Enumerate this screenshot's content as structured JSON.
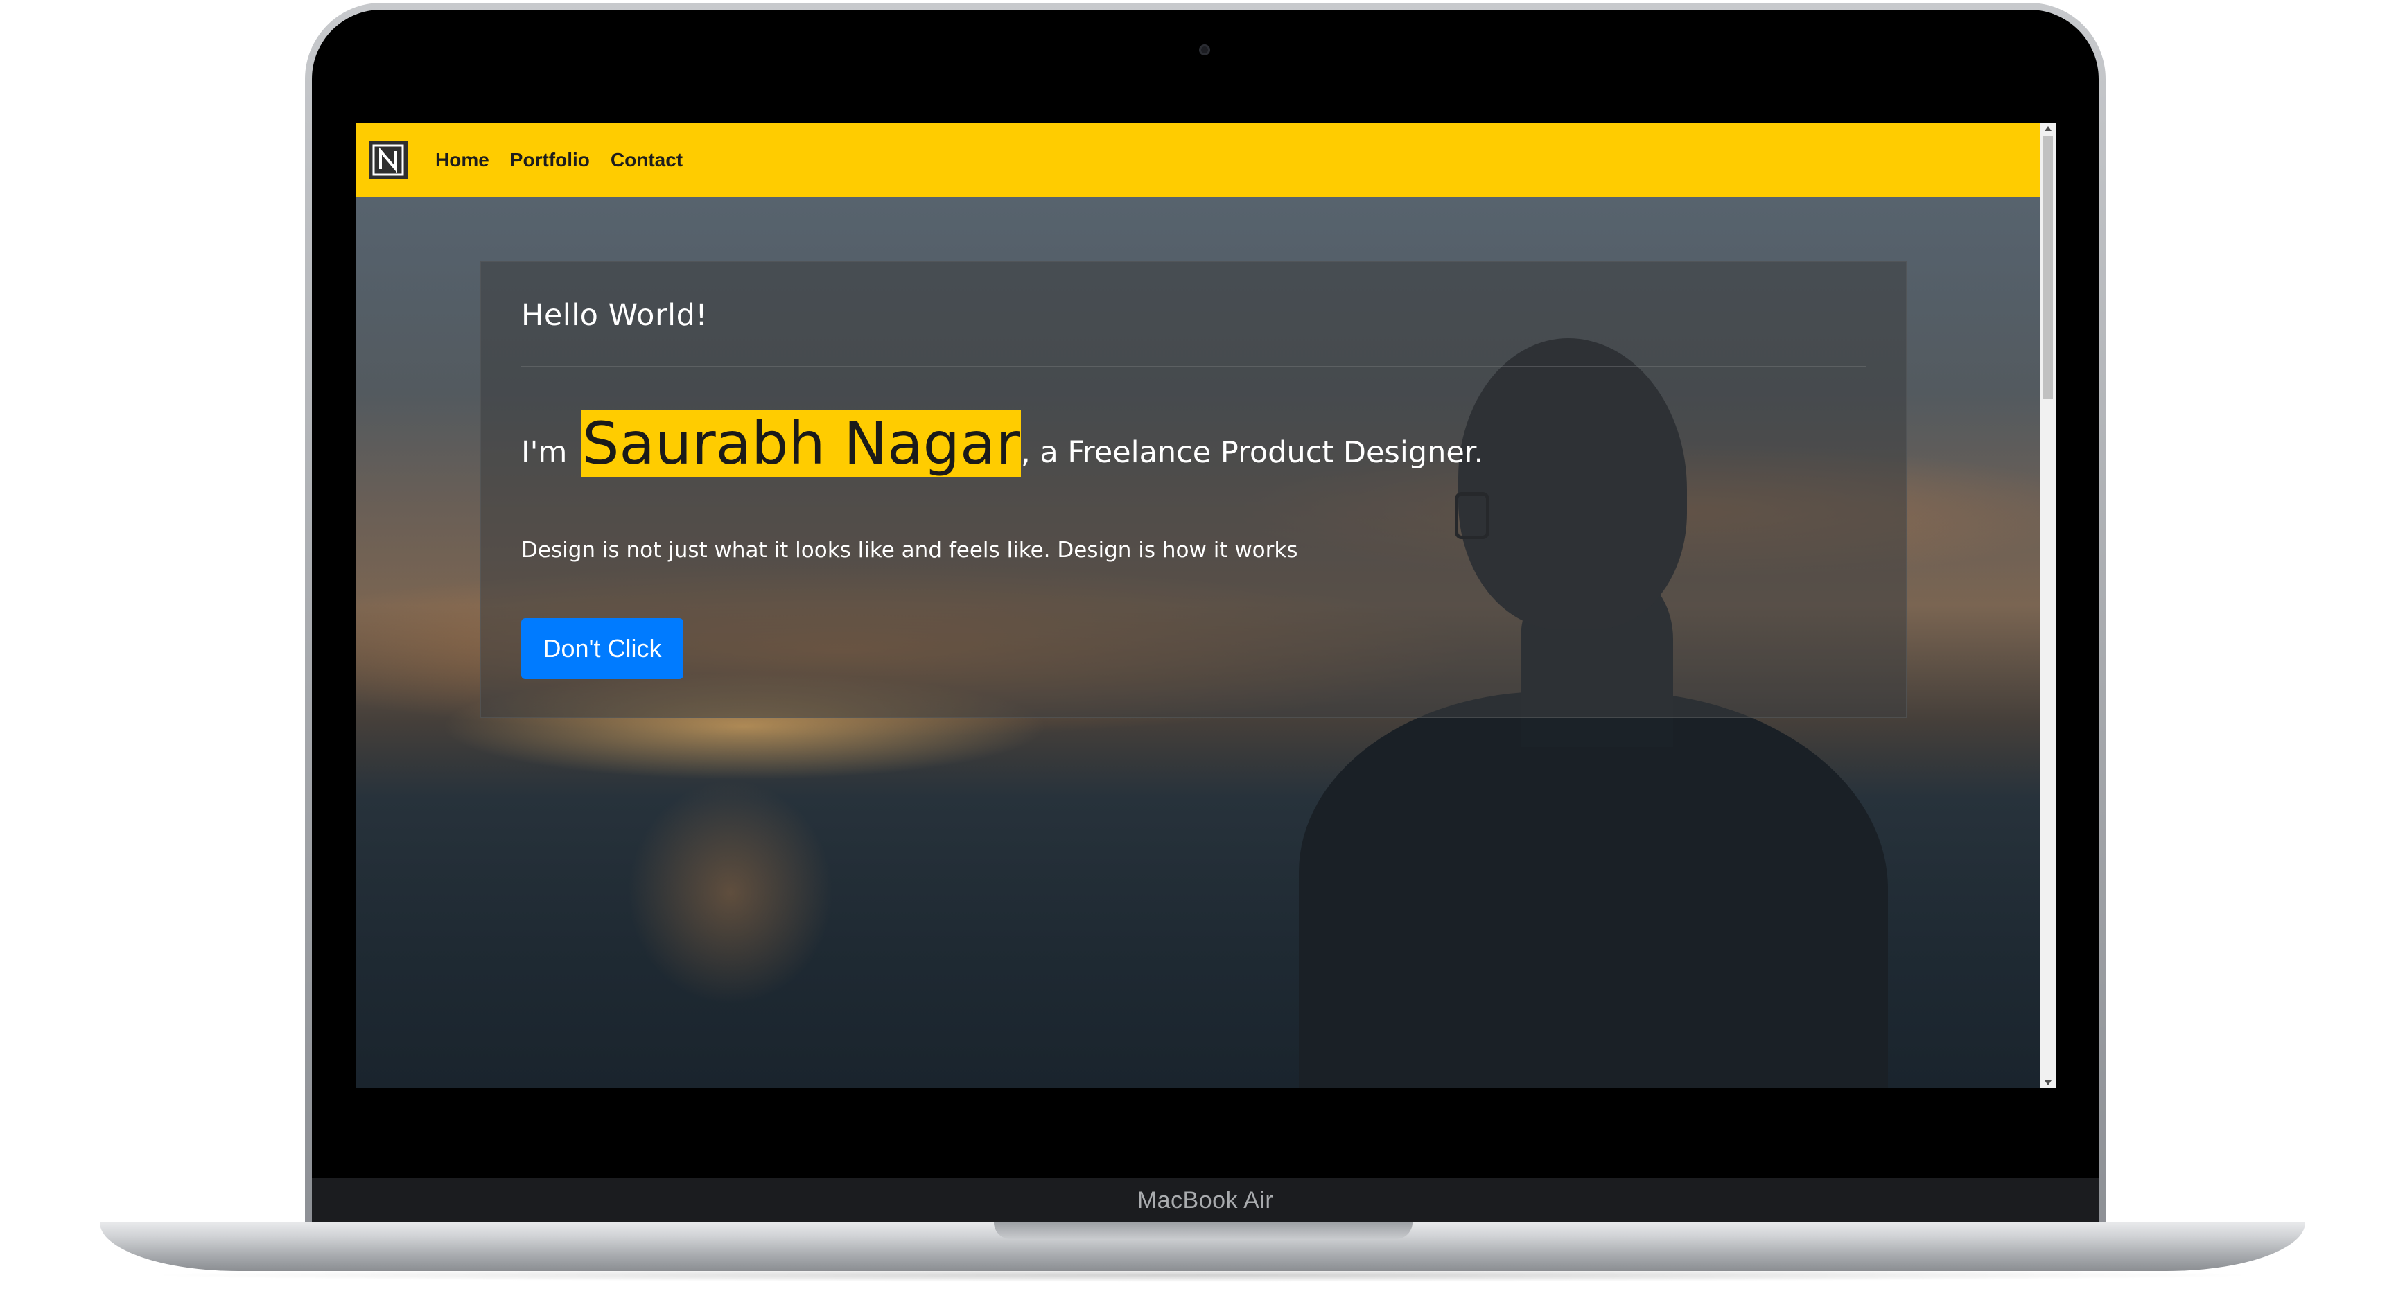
{
  "device": {
    "model_label": "MacBook Air"
  },
  "navbar": {
    "logo_icon": "n-logo-icon",
    "links": [
      {
        "label": "Home"
      },
      {
        "label": "Portfolio"
      },
      {
        "label": "Contact"
      }
    ],
    "background_color": "#ffcc00"
  },
  "hero": {
    "greeting": "Hello World!",
    "headline_prefix": "I'm ",
    "name": "Saurabh Nagar",
    "headline_suffix": ", a Freelance Product Designer.",
    "tagline": "Design is not just what it looks like and feels like. Design is how it works",
    "button_label": "Don't Click",
    "button_color": "#007bff",
    "name_highlight_color": "#ffcc00"
  }
}
